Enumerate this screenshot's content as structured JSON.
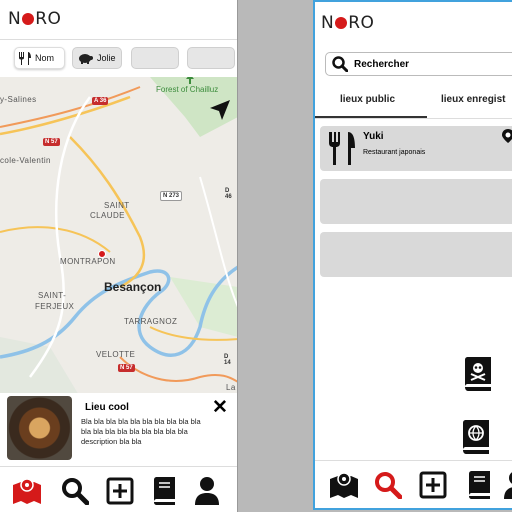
{
  "brand": {
    "logo_left": "N",
    "logo_right": "RO",
    "accent": "#d51a1a"
  },
  "left_screen": {
    "filters": [
      {
        "label": "Nom",
        "icon": "utensils-icon",
        "active": true
      },
      {
        "label": "Jolie",
        "icon": "pig-icon",
        "active": false
      },
      {
        "label": "",
        "active": false
      },
      {
        "label": "",
        "active": false
      }
    ],
    "map": {
      "labels": {
        "salines": "y-Salines",
        "valentin": "cole-Valentin",
        "forest": "Forest of Chailluz",
        "saint_claude_1": "SAINT",
        "saint_claude_2": "CLAUDE",
        "montrapon": "MONTRAPON",
        "besancon": "Besançon",
        "saint_ferjeux_1": "SAINT-",
        "saint_ferjeux_2": "FERJEUX",
        "tarragnoz": "TARRAGNOZ",
        "velotte": "VELOTTE",
        "la": "La"
      },
      "roads": {
        "a36": "A 36",
        "n57_top": "N 57",
        "n273": "N 273",
        "d_right": "D 46",
        "n57_bottom": "N 57",
        "d14": "D 14"
      }
    },
    "popup": {
      "title": "Lieu cool",
      "description": "Bla bla bla bla bla bla bla bla bla bla bla bla bla bla bla bla bla bla bla description bla bla",
      "close": "✕"
    },
    "nav": [
      "map-icon",
      "search-icon",
      "add-icon",
      "book-icon",
      "user-icon"
    ]
  },
  "right_screen": {
    "search": {
      "placeholder": "Rechercher"
    },
    "tabs": [
      "lieux public",
      "lieux enregist"
    ],
    "cards": [
      {
        "name": "Yuki",
        "subtitle": "Restaurant japonais"
      },
      {
        "name": "",
        "subtitle": ""
      },
      {
        "name": "",
        "subtitle": ""
      }
    ],
    "nav": [
      "map-icon",
      "search-icon",
      "add-icon",
      "book-icon",
      "user-icon"
    ]
  }
}
